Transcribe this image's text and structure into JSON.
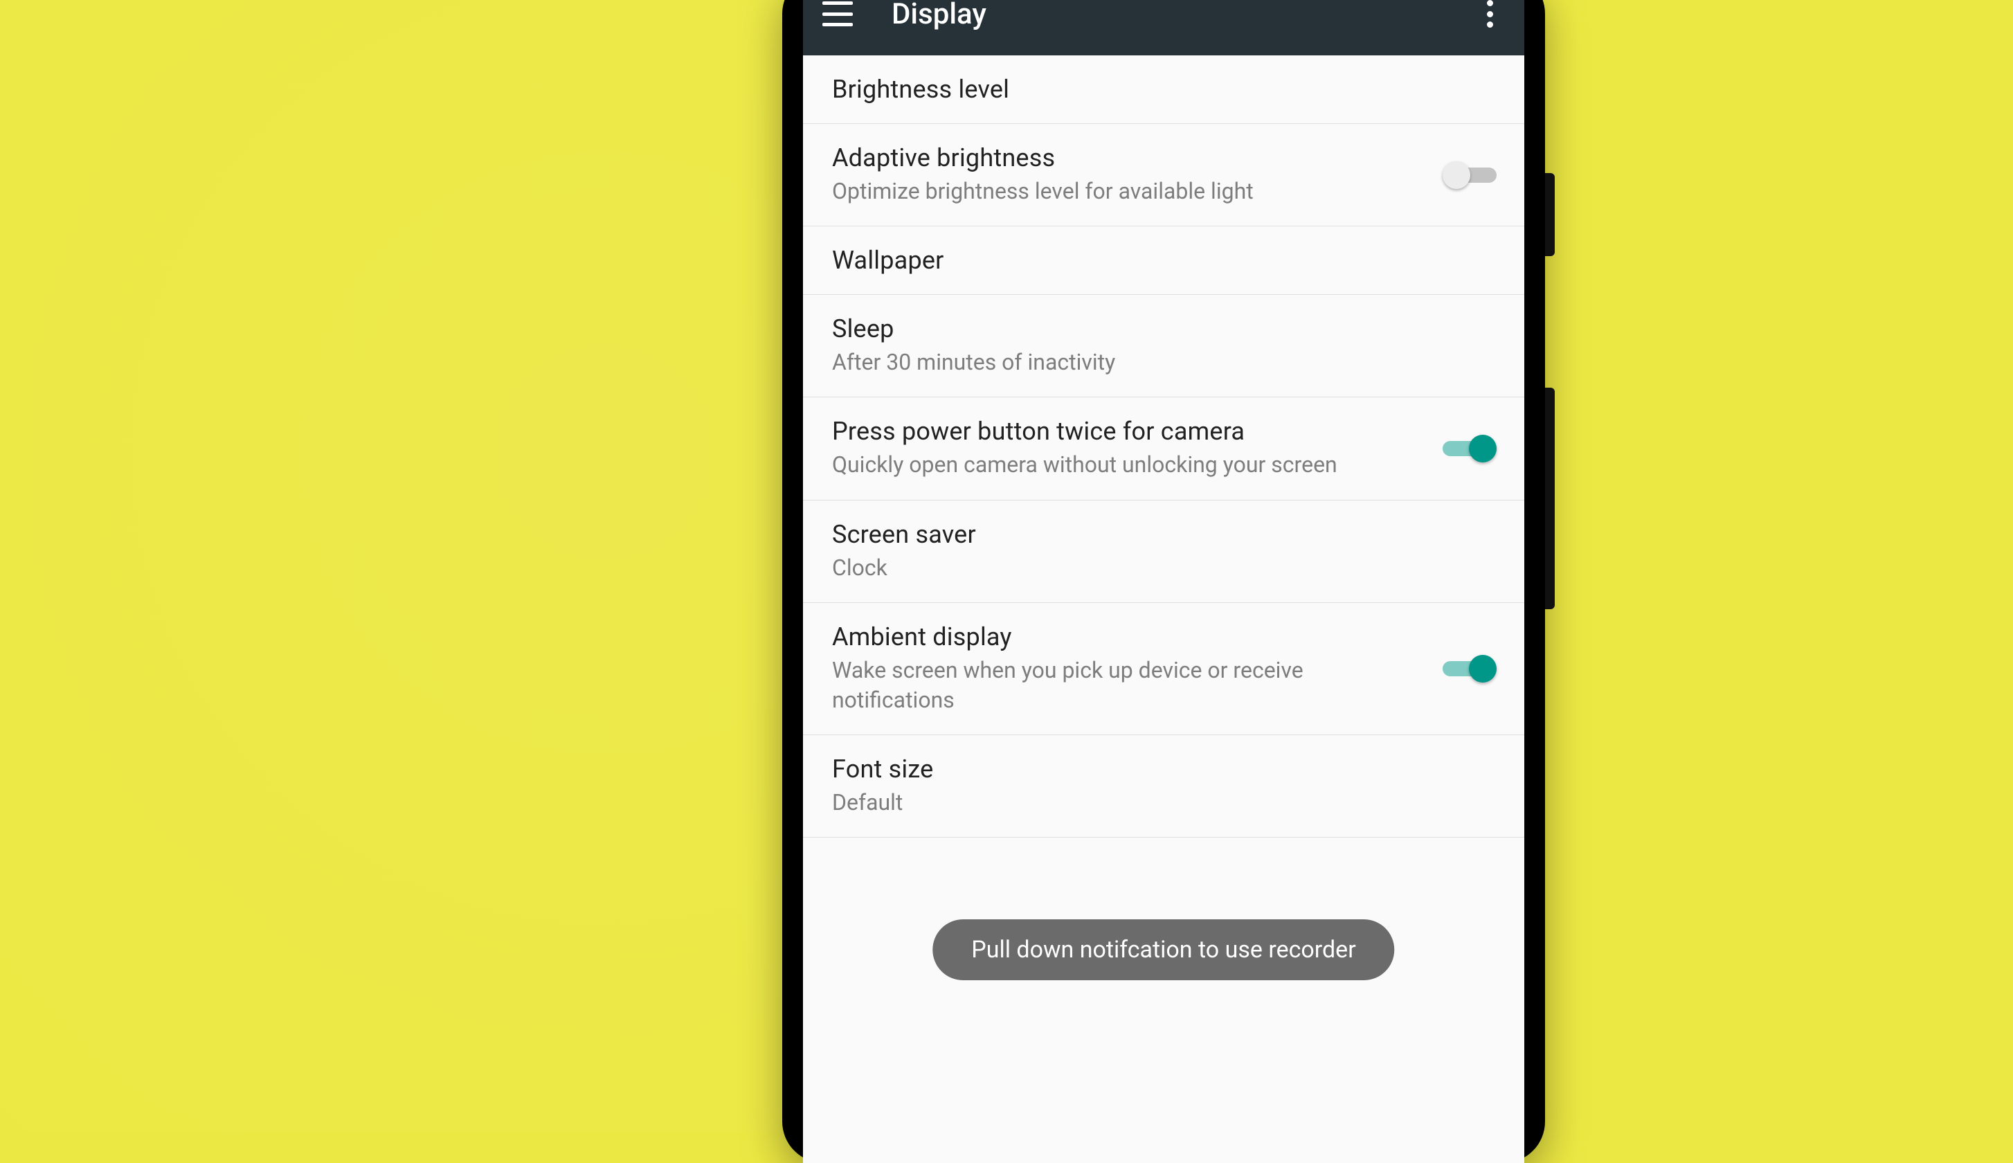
{
  "appbar": {
    "title": "Display"
  },
  "items": [
    {
      "title": "Brightness level"
    },
    {
      "title": "Adaptive brightness",
      "subtitle": "Optimize brightness level for available light",
      "switch": "off"
    },
    {
      "title": "Wallpaper"
    },
    {
      "title": "Sleep",
      "subtitle": "After 30 minutes of inactivity"
    },
    {
      "title": "Press power button twice for camera",
      "subtitle": "Quickly open camera without unlocking your screen",
      "switch": "on"
    },
    {
      "title": "Screen saver",
      "subtitle": "Clock"
    },
    {
      "title": "Ambient display",
      "subtitle": "Wake screen when you pick up device or receive notifications",
      "switch": "on"
    },
    {
      "title": "Font size",
      "subtitle": "Default"
    }
  ],
  "toast": "Pull down notifcation to use recorder",
  "colors": {
    "accent": "#009688",
    "appbar": "#263238",
    "background_page": "#ece843",
    "toast": "#6b6b6b"
  }
}
